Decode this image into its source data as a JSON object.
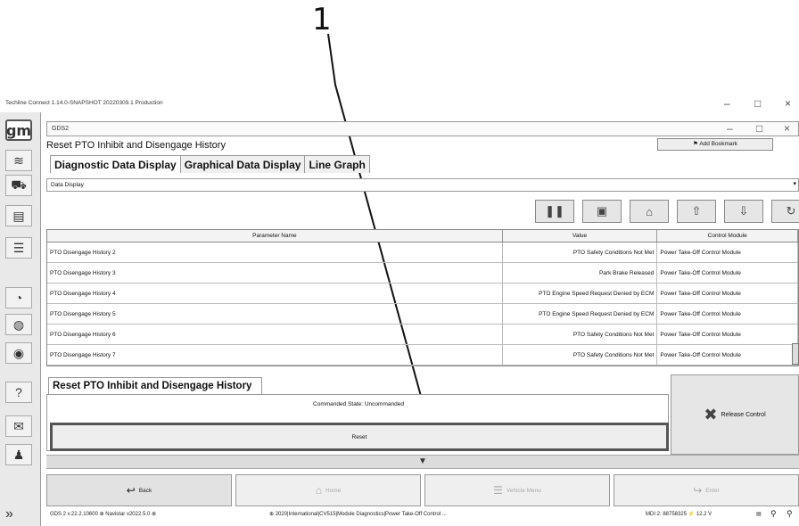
{
  "callout": {
    "number": "1"
  },
  "window": {
    "title": "Techline Connect 1.14.0-SNAPSHOT 20220309.1 Production",
    "minimize": "–",
    "maximize": "□",
    "close": "×"
  },
  "sidebar": {
    "logo": "gm",
    "items": [
      {
        "icon": "wifi-icon",
        "glyph": "≋"
      },
      {
        "icon": "vehicle-icon",
        "glyph": "⛟"
      },
      {
        "icon": "document-icon",
        "glyph": "▤"
      },
      {
        "icon": "list-icon",
        "glyph": "☰"
      },
      {
        "icon": "gauge-icon",
        "glyph": "◔"
      },
      {
        "icon": "globe-icon",
        "glyph": "◍"
      },
      {
        "icon": "steering-icon",
        "glyph": "◉"
      },
      {
        "icon": "help-icon",
        "glyph": "?"
      },
      {
        "icon": "mail-icon",
        "glyph": "✉"
      },
      {
        "icon": "user-icon",
        "glyph": "♟"
      }
    ],
    "expand": "»"
  },
  "gds": {
    "tab_title": "GDS2",
    "page_title": "Reset PTO Inhibit and Disengage History",
    "bookmark_label": "Add Bookmark",
    "tabs": [
      "Diagnostic Data Display",
      "Graphical Data Display",
      "Line Graph"
    ],
    "dropdown_value": "Data Display",
    "toolbar": [
      {
        "icon": "pause-icon",
        "glyph": "❚❚"
      },
      {
        "icon": "record-icon",
        "glyph": "▣"
      },
      {
        "icon": "lock-icon",
        "glyph": "⌂"
      },
      {
        "icon": "arrow-up-icon",
        "glyph": "⇧"
      },
      {
        "icon": "arrow-down-icon",
        "glyph": "⇩"
      },
      {
        "icon": "refresh-icon",
        "glyph": "↻"
      }
    ]
  },
  "grid": {
    "headers": [
      "Parameter Name",
      "Value",
      "Control Module"
    ],
    "rows": [
      [
        "PTO Disengage History 2",
        "PTO Safety Conditions Not Met",
        "Power Take-Off Control Module"
      ],
      [
        "PTO Disengage History 3",
        "Park Brake Released",
        "Power Take-Off Control Module"
      ],
      [
        "PTO Disengage History 4",
        "PTO Engine Speed Request Denied by ECM",
        "Power Take-Off Control Module"
      ],
      [
        "PTO Disengage History 5",
        "PTO Engine Speed Request Denied by ECM",
        "Power Take-Off Control Module"
      ],
      [
        "PTO Disengage History 6",
        "PTO Safety Conditions Not Met",
        "Power Take-Off Control Module"
      ],
      [
        "PTO Disengage History 7",
        "PTO Safety Conditions Not Met",
        "Power Take-Off Control Module"
      ]
    ]
  },
  "control": {
    "section_title": "Reset PTO Inhibit and Disengage History",
    "commanded_state": "Commanded State: Uncommanded",
    "reset_label": "Reset",
    "release_label": "Release Control"
  },
  "nav": {
    "back": "Back",
    "home": "Home",
    "vehicle_menu": "Vehicle Menu",
    "enter": "Enter"
  },
  "status": {
    "left": "GDS 2 v.22.2.10600  ⊕ Navistar v2022.5.0  ⊕",
    "center": "⊕ 2020|International|CV515|Module Diagnostics|Power Take-Off Control ...",
    "right": "MDI 2: 88758325  ⚡ 12.2 V"
  }
}
